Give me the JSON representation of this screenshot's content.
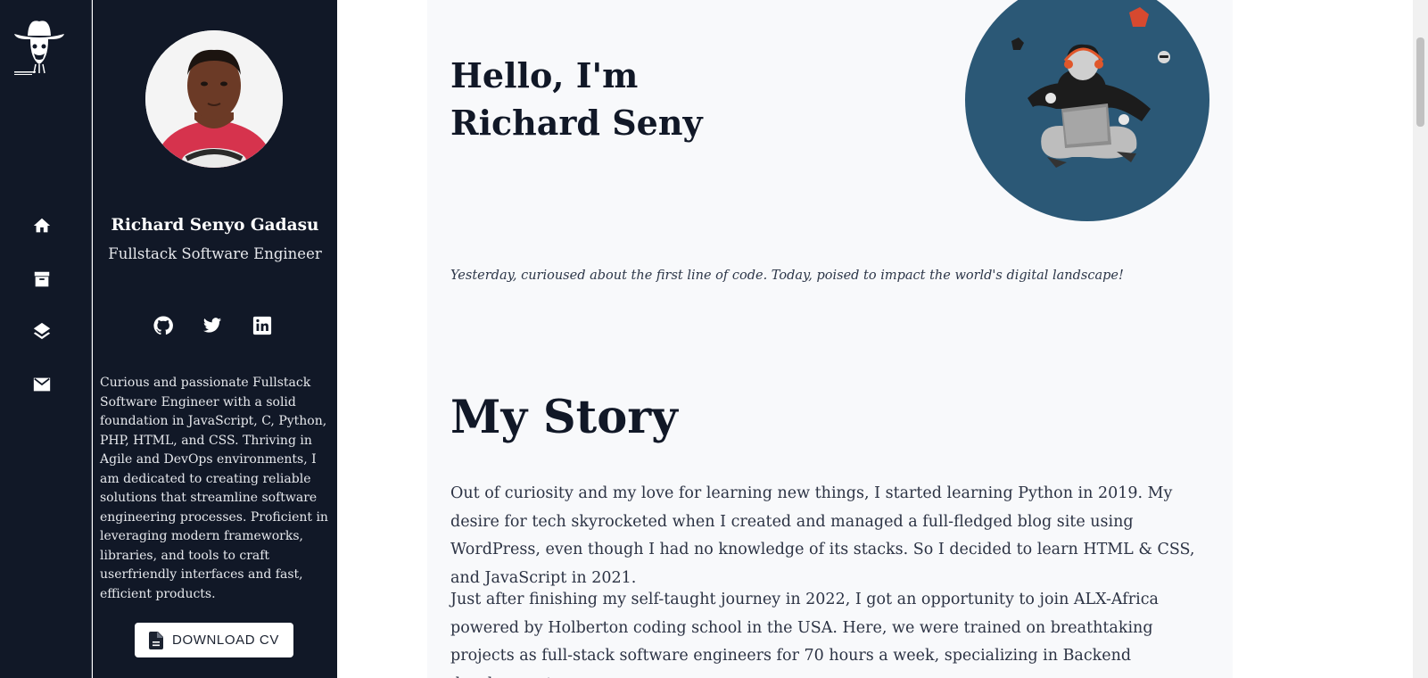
{
  "rail": {
    "nav": [
      {
        "name": "home",
        "icon": "home-icon"
      },
      {
        "name": "archive",
        "icon": "archive-icon"
      },
      {
        "name": "layers",
        "icon": "layers-icon"
      },
      {
        "name": "mail",
        "icon": "mail-icon"
      }
    ]
  },
  "profile": {
    "name": "Richard Senyo Gadasu",
    "role": "Fullstack Software Engineer",
    "socials": [
      {
        "name": "github",
        "icon": "github-icon"
      },
      {
        "name": "twitter",
        "icon": "twitter-icon"
      },
      {
        "name": "linkedin",
        "icon": "linkedin-icon"
      }
    ],
    "bio": "Curious and passionate Fullstack Software Engineer with a solid foundation in JavaScript, C, Python, PHP, HTML, and CSS. Thriving in Agile and DevOps environments, I am dedicated to creating reliable solutions that streamline software engineering processes. Proficient in leveraging modern frameworks, libraries, and tools to craft userfriendly interfaces and fast, efficient products.",
    "cv_button": "DOWNLOAD CV"
  },
  "hero": {
    "greeting_line1": "Hello, I'm",
    "greeting_line2": "Richard Seny",
    "tagline": "Yesterday, curioused about the first line of code. Today, poised to impact the world's digital landscape!"
  },
  "story": {
    "title": "My Story",
    "paragraphs": [
      "Out of curiosity and my love for learning new things, I started learning Python in 2019. My desire for tech skyrocketed when I created and managed a full-fledged blog site using WordPress, even though I had no knowledge of its stacks. So I decided to learn HTML & CSS, and JavaScript in 2021.",
      "Just after finishing my self-taught journey in 2022, I got an opportunity to join ALX-Africa powered by Holberton coding school in the USA. Here, we were trained on breathtaking projects as full-stack software engineers for 70 hours a week, specializing in Backend development."
    ]
  },
  "colors": {
    "sidebar_bg": "#111827",
    "main_bg": "#f8f9fb",
    "hero_circle": "#2b5876",
    "heading": "#111827"
  }
}
